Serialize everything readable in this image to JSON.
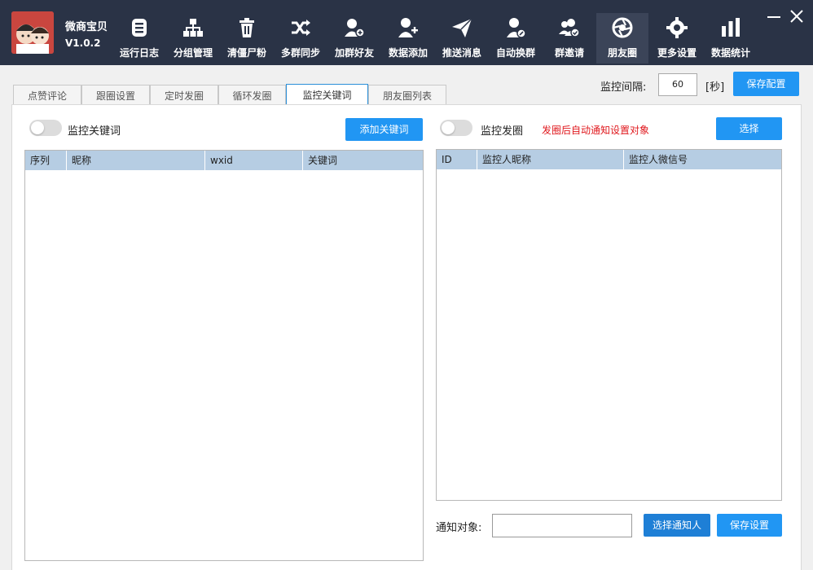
{
  "app": {
    "name": "微商宝贝",
    "version": "V1.0.2"
  },
  "nav": [
    {
      "label": "运行日志",
      "icon": "log-list-icon"
    },
    {
      "label": "分组管理",
      "icon": "org-tree-icon"
    },
    {
      "label": "清僵尸粉",
      "icon": "trash-icon"
    },
    {
      "label": "多群同步",
      "icon": "shuffle-icon"
    },
    {
      "label": "加群好友",
      "icon": "add-friend-icon"
    },
    {
      "label": "数据添加",
      "icon": "add-user-icon"
    },
    {
      "label": "推送消息",
      "icon": "send-plane-icon"
    },
    {
      "label": "自动换群",
      "icon": "user-edit-icon"
    },
    {
      "label": "群邀请",
      "icon": "group-check-icon"
    },
    {
      "label": "朋友圈",
      "icon": "aperture-icon"
    },
    {
      "label": "更多设置",
      "icon": "gear-icon"
    },
    {
      "label": "数据统计",
      "icon": "bar-chart-icon"
    }
  ],
  "active_nav": "朋友圈",
  "tabs": [
    "点赞评论",
    "跟圈设置",
    "定时发圈",
    "循环发圈",
    "监控关键词",
    "朋友圈列表"
  ],
  "active_tab": "监控关键词",
  "monitor": {
    "interval_label": "监控间隔:",
    "interval_value": "60",
    "unit": "[秒]",
    "save_config": "保存配置"
  },
  "left": {
    "toggle_label": "监控关键词",
    "add_button": "添加关键词",
    "columns": [
      "序列",
      "昵称",
      "wxid",
      "关键词"
    ],
    "rows": []
  },
  "right": {
    "toggle_label": "监控发圈",
    "hint": "发圈后自动通知设置对象",
    "select_button": "选择",
    "columns": [
      "ID",
      "监控人昵称",
      "监控人微信号"
    ],
    "rows": [],
    "notify_label": "通知对象:",
    "notify_value": "",
    "select_notify_button": "选择通知人",
    "save_button": "保存设置"
  },
  "colors": {
    "topbar": "#2a3346",
    "accent": "#2196f3",
    "grid_header": "#b6cde3",
    "hint": "#e0191e"
  }
}
